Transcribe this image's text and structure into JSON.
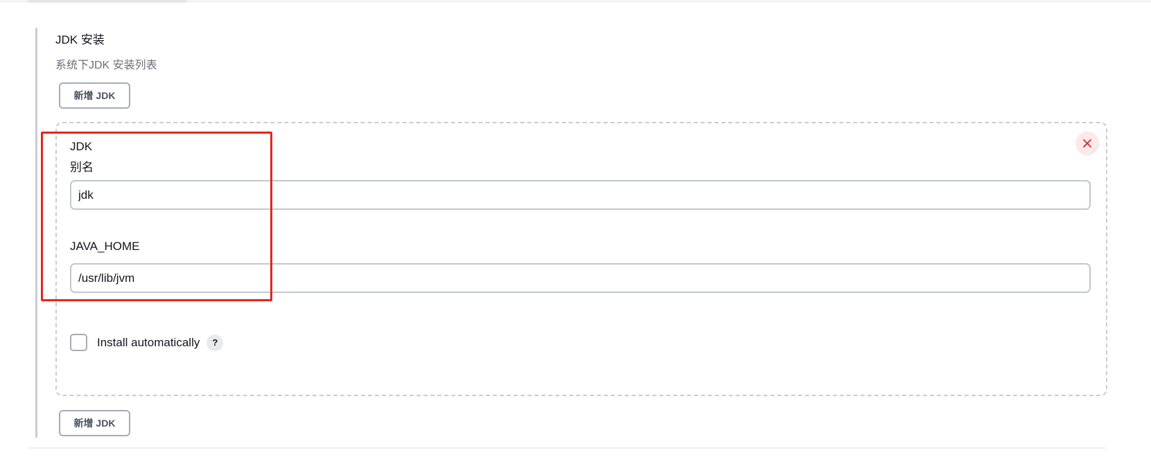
{
  "section": {
    "title": "JDK 安装",
    "description": "系统下JDK 安装列表",
    "add_button_label": "新增 JDK"
  },
  "installation": {
    "name_label_line1": "JDK",
    "name_label_line2": "别名",
    "name_value": "jdk",
    "java_home_label": "JAVA_HOME",
    "java_home_value": "/usr/lib/jvm",
    "install_automatically_label": "Install automatically",
    "install_automatically_checked": false,
    "help_glyph": "?",
    "close_glyph": "✕"
  },
  "icons": {
    "close": "close-icon",
    "help": "help-icon"
  },
  "colors": {
    "highlight": "#e8231b",
    "close_icon": "#d72531",
    "close_bg": "#fde8ea"
  }
}
